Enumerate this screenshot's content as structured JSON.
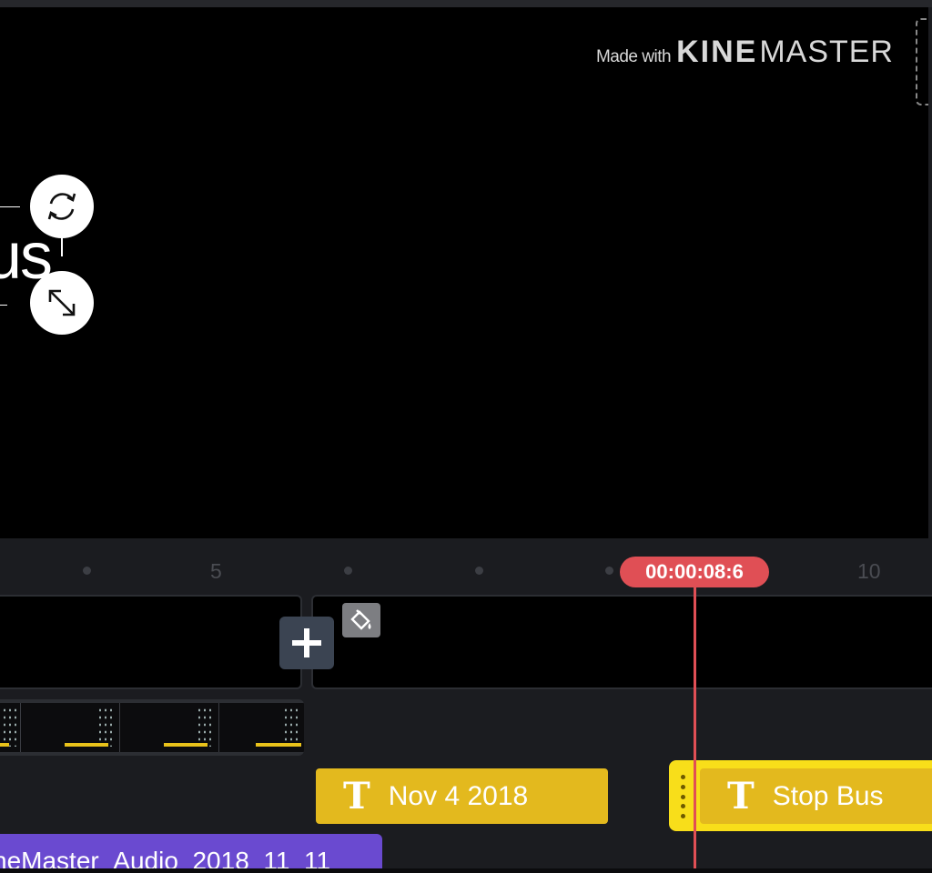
{
  "preview": {
    "watermark_made_with": "Made with",
    "watermark_brand_bold": "KINE",
    "watermark_brand_light": "MASTER",
    "text_layer_content": "us"
  },
  "ruler": {
    "tick_labels": [
      "5",
      "10"
    ],
    "timecode": "00:00:08:6"
  },
  "timeline": {
    "title_clips": [
      {
        "label": "Nov 4 2018"
      },
      {
        "label": "Stop Bus"
      }
    ],
    "audio_clip_label": "neMaster_Audio_2018_11_11"
  },
  "icons": {
    "rotate": "rotate-icon",
    "resize": "resize-icon",
    "add": "plus-icon",
    "fill": "paint-bucket-icon",
    "title": "text-t-icon"
  },
  "colors": {
    "playhead": "#e04f55",
    "title_clip": "#e3b91e",
    "selected_clip": "#f8de1a",
    "audio_clip": "#6a4ad0"
  }
}
